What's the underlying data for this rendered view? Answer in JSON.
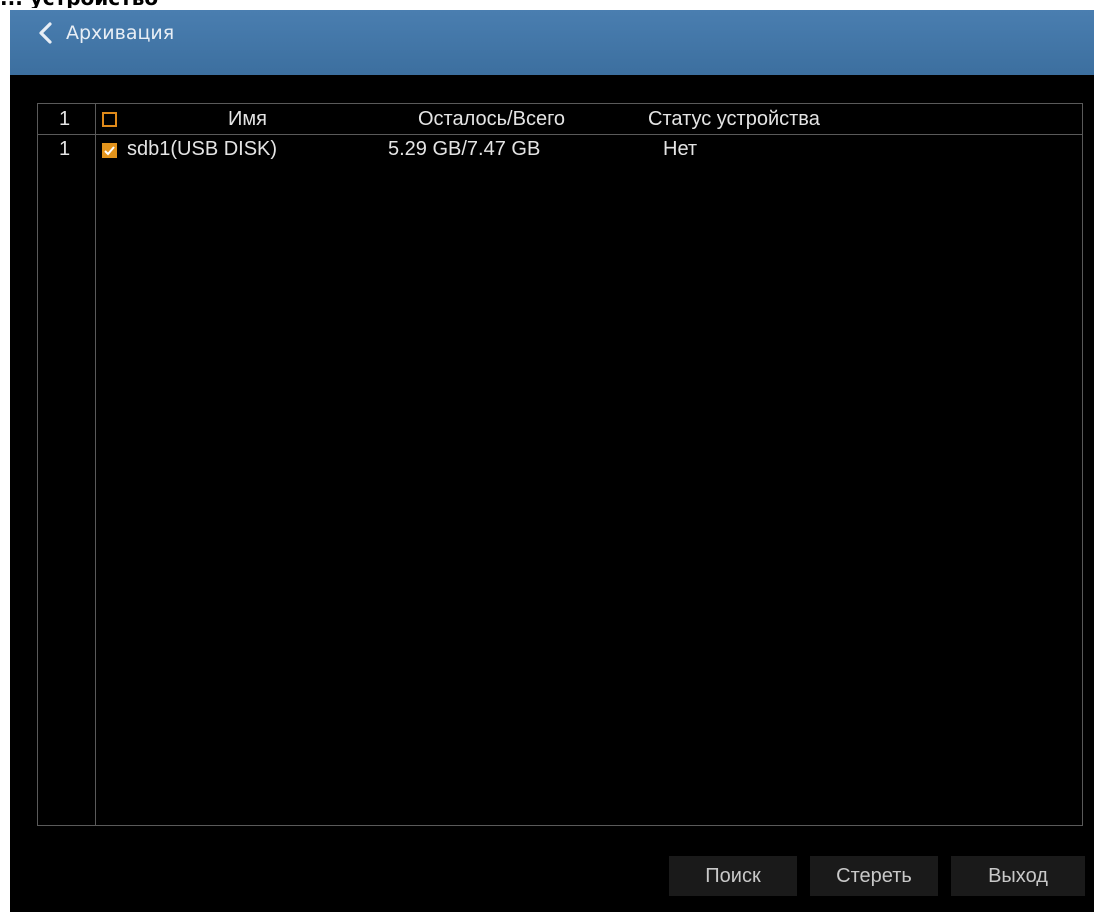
{
  "page_caption": "... устройство",
  "window": {
    "title": "Архивация",
    "back_icon": "chevron-left-icon",
    "title_bar_color": "#3c6f9f"
  },
  "table": {
    "header": {
      "index": "1",
      "select_all_checked": false,
      "name": "Имя",
      "remaining_total": "Осталось/Всего",
      "device_status": "Статус устройства"
    },
    "rows": [
      {
        "index": "1",
        "checked": true,
        "name": "sdb1(USB DISK)",
        "remaining_total": "5.29 GB/7.47 GB",
        "device_status": "Нет"
      }
    ]
  },
  "buttons": {
    "search": "Поиск",
    "erase": "Стереть",
    "exit": "Выход"
  },
  "colors": {
    "accent_checkbox": "#e3941c",
    "background": "#000000",
    "grid_line": "#5a5a5a"
  }
}
